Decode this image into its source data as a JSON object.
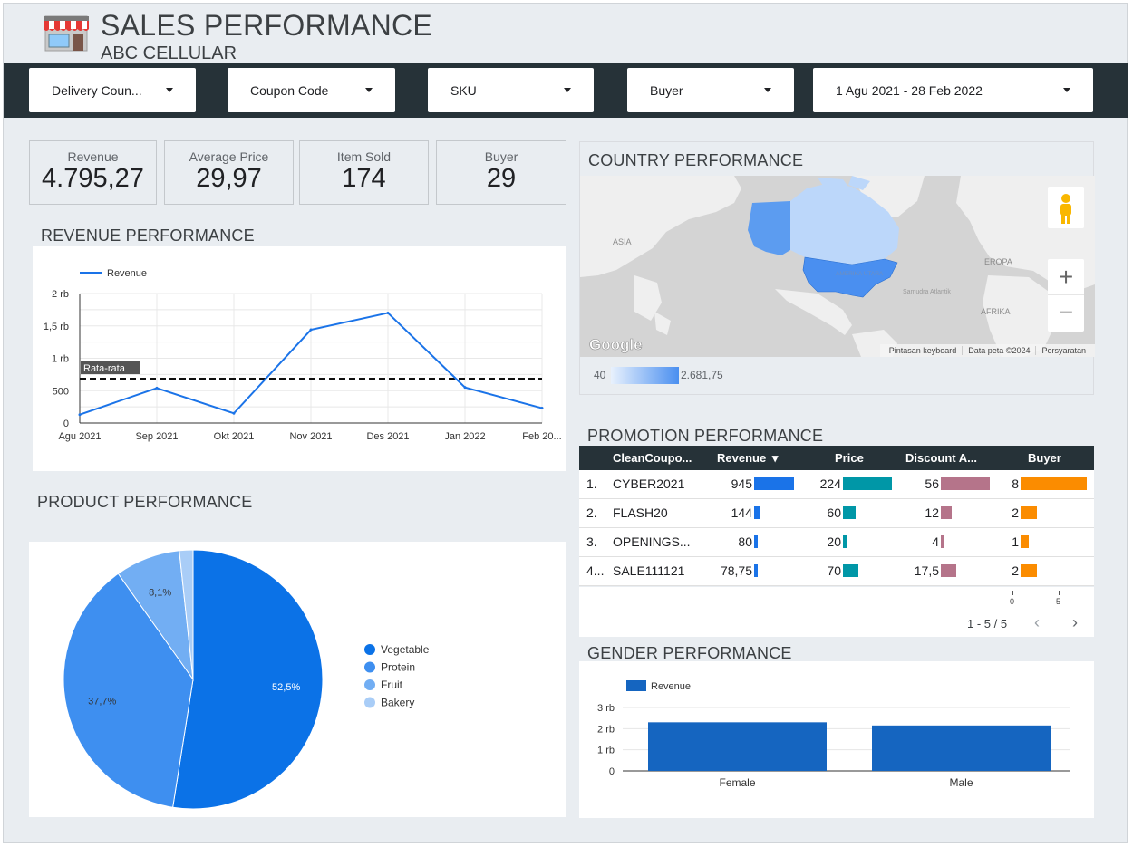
{
  "header": {
    "title": "SALES PERFORMANCE",
    "subtitle": "ABC CELLULAR",
    "logo_icon": "store-icon"
  },
  "filters": [
    {
      "label": "Delivery Coun..."
    },
    {
      "label": "Coupon Code"
    },
    {
      "label": "SKU"
    },
    {
      "label": "Buyer"
    },
    {
      "label": "1 Agu 2021 - 28 Feb 2022"
    }
  ],
  "kpis": [
    {
      "label": "Revenue",
      "value": "4.795,27"
    },
    {
      "label": "Average Price",
      "value": "29,97"
    },
    {
      "label": "Item Sold",
      "value": "174"
    },
    {
      "label": "Buyer",
      "value": "29"
    }
  ],
  "sections": {
    "revenue": "REVENUE PERFORMANCE",
    "product": "PRODUCT PERFORMANCE",
    "country": "COUNTRY PERFORMANCE",
    "promotion": "PROMOTION PERFORMANCE",
    "gender": "GENDER PERFORMANCE"
  },
  "colors": {
    "dark_bar": "#263238",
    "line_blue": "#1a73e8",
    "revenue_bar": "#1a73e8",
    "price_bar": "#0097a7",
    "discount_bar": "#b5748a",
    "buyer_bar": "#fb8c00",
    "pie": [
      "#0b72e7",
      "#3e8ff0",
      "#72aef3",
      "#a9cdf7"
    ],
    "gender_bar": "#1565c0"
  },
  "chart_data": [
    {
      "type": "line",
      "legend": [
        "Revenue"
      ],
      "categories": [
        "Agu 2021",
        "Sep 2021",
        "Okt 2021",
        "Nov 2021",
        "Des 2021",
        "Jan 2022",
        "Feb 20..."
      ],
      "series": [
        {
          "name": "Revenue",
          "values": [
            130,
            540,
            150,
            1440,
            1700,
            550,
            230
          ]
        }
      ],
      "average_label": "Rata-rata",
      "average": 685,
      "y_ticks": [
        "0",
        "500",
        "1 rb",
        "1,5 rb",
        "2 rb"
      ],
      "ylim": [
        0,
        2000
      ],
      "grid": true
    },
    {
      "type": "pie",
      "labels": [
        "Vegetable",
        "Protein",
        "Fruit",
        "Bakery"
      ],
      "values": [
        52.5,
        37.7,
        8.1,
        1.7
      ],
      "slice_labels": [
        "52,5%",
        "37,7%",
        "8,1%",
        ""
      ],
      "legend": "right"
    },
    {
      "type": "bar",
      "legend": [
        "Revenue"
      ],
      "categories": [
        "Female",
        "Male"
      ],
      "values": [
        2300,
        2150
      ],
      "y_ticks": [
        "0",
        "1 rb",
        "2 rb",
        "3 rb"
      ],
      "ylim": [
        0,
        3000
      ]
    },
    {
      "type": "table",
      "columns": [
        "CleanCoupo...",
        "Revenue",
        "Price",
        "Discount A...",
        "Buyer"
      ],
      "sort_indicator": "▾",
      "rows": [
        {
          "index": "1.",
          "coupon": "CYBER2021",
          "revenue": "945",
          "price": "224",
          "discount": "56",
          "buyer": "8",
          "revenue_n": 945,
          "price_n": 224,
          "discount_n": 56,
          "buyer_n": 8
        },
        {
          "index": "2.",
          "coupon": "FLASH20",
          "revenue": "144",
          "price": "60",
          "discount": "12",
          "buyer": "2",
          "revenue_n": 144,
          "price_n": 60,
          "discount_n": 12,
          "buyer_n": 2
        },
        {
          "index": "3.",
          "coupon": "OPENINGS...",
          "revenue": "80",
          "price": "20",
          "discount": "4",
          "buyer": "1",
          "revenue_n": 80,
          "price_n": 20,
          "discount_n": 4,
          "buyer_n": 1
        },
        {
          "index": "4...",
          "coupon": "SALE111121",
          "revenue": "78,75",
          "price": "70",
          "discount": "17,5",
          "buyer": "2",
          "revenue_n": 78.75,
          "price_n": 70,
          "discount_n": 17.5,
          "buyer_n": 2
        }
      ],
      "buyer_axis_ticks": [
        "0",
        "5"
      ],
      "pagination": "1 - 5 / 5"
    }
  ],
  "map": {
    "labels": [
      "ASIA",
      "EROPA",
      "AFRIKA",
      "AMERIKA UTARA",
      "Samudra Atlantik"
    ],
    "footer": [
      "Pintasan keyboard",
      "Data peta ©2024",
      "Persyaratan"
    ],
    "google": "Google",
    "scale_min": "40",
    "scale_max": "2.681,75",
    "zoom_in": "+",
    "zoom_out": "−"
  }
}
